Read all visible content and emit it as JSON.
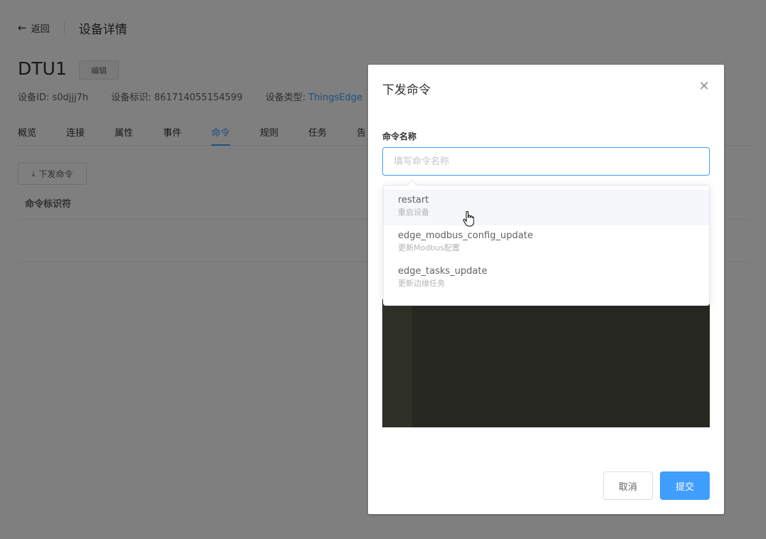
{
  "header": {
    "back_label": "返回",
    "title": "设备详情"
  },
  "device": {
    "name": "DTU1",
    "edit_label": "编辑",
    "id_label": "设备ID: s0djjj7h",
    "ident_label": "设备标识: 861714055154599",
    "type_label": "设备类型:",
    "type_value": "ThingsEdge"
  },
  "tabs": [
    {
      "label": "概览"
    },
    {
      "label": "连接"
    },
    {
      "label": "属性"
    },
    {
      "label": "事件"
    },
    {
      "label": "命令",
      "active": true
    },
    {
      "label": "规则"
    },
    {
      "label": "任务"
    },
    {
      "label": "告"
    }
  ],
  "toolbar": {
    "send_command_label": "下发命令"
  },
  "table": {
    "columns": [
      "命令标识符"
    ]
  },
  "dialog": {
    "title": "下发命令",
    "field_label": "命令名称",
    "input_placeholder": "填写命令名称",
    "input_value": "",
    "cancel_label": "取消",
    "submit_label": "提交"
  },
  "dropdown": {
    "options": [
      {
        "name": "restart",
        "desc": "重启设备"
      },
      {
        "name": "edge_modbus_config_update",
        "desc": "更新Modbus配置"
      },
      {
        "name": "edge_tasks_update",
        "desc": "更新边缘任务"
      }
    ]
  },
  "colors": {
    "primary": "#409eff",
    "mask": "rgba(0,0,0,0.5)",
    "editor_bg": "#272822"
  }
}
